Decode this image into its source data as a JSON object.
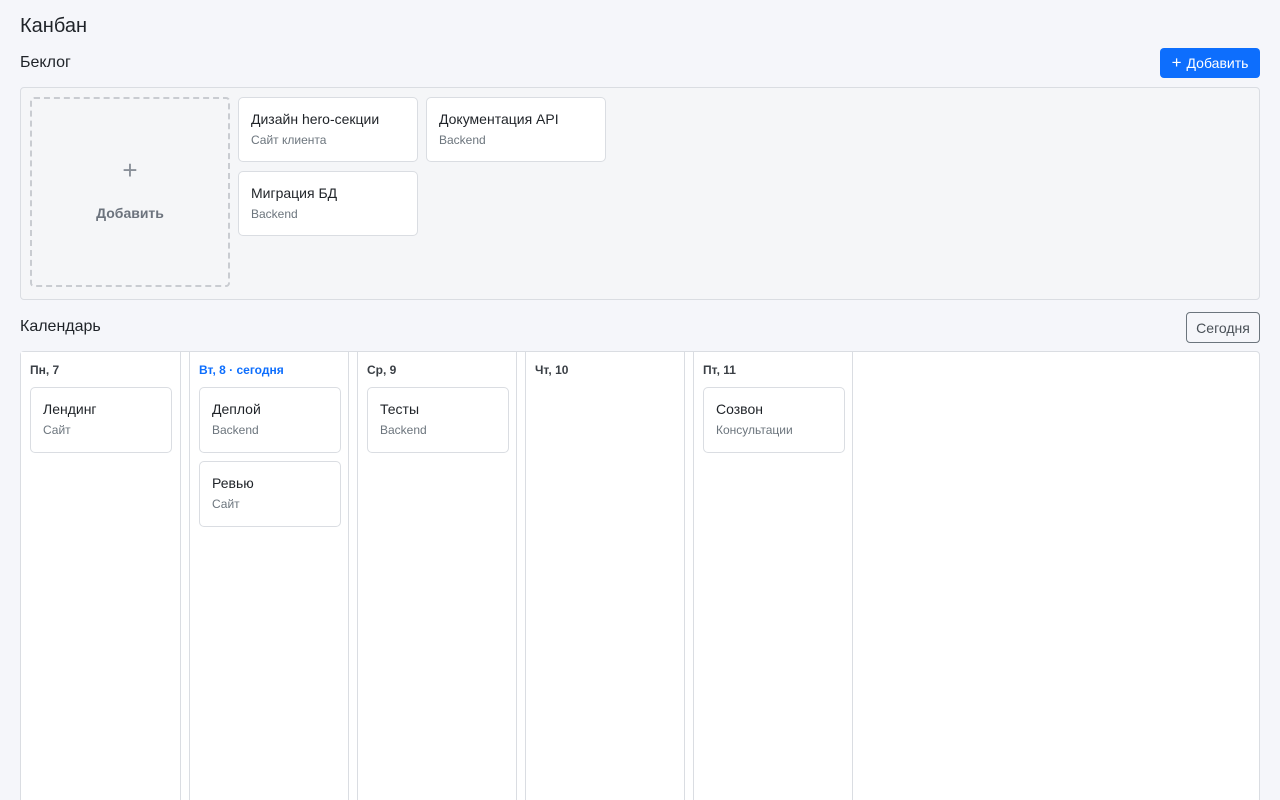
{
  "page": {
    "title": "Канбан"
  },
  "backlog": {
    "title": "Беклог",
    "add_button": "Добавить",
    "add_tile_label": "Добавить",
    "cards": [
      {
        "title": "Дизайн hero-секции",
        "subtitle": "Сайт клиента"
      },
      {
        "title": "Документация API",
        "subtitle": "Backend"
      },
      {
        "title": "Миграция БД",
        "subtitle": "Backend"
      }
    ]
  },
  "calendar": {
    "title": "Календарь",
    "today_button": "Сегодня",
    "days": [
      {
        "label": "Пн, 7",
        "is_today": false,
        "cards": [
          {
            "title": "Лендинг",
            "subtitle": "Сайт"
          }
        ]
      },
      {
        "label": "Вт, 8 · сегодня",
        "is_today": true,
        "cards": [
          {
            "title": "Деплой",
            "subtitle": "Backend"
          },
          {
            "title": "Ревью",
            "subtitle": "Сайт"
          }
        ]
      },
      {
        "label": "Ср, 9",
        "is_today": false,
        "cards": [
          {
            "title": "Тесты",
            "subtitle": "Backend"
          }
        ]
      },
      {
        "label": "Чт, 10",
        "is_today": false,
        "cards": []
      },
      {
        "label": "Пт, 11",
        "is_today": false,
        "cards": [
          {
            "title": "Созвон",
            "subtitle": "Консультации"
          }
        ]
      }
    ]
  },
  "colors": {
    "accent": "#0d6efd",
    "background": "#f5f6fa",
    "card_border": "#dadde2"
  },
  "icons": {
    "add_button_icon": "plus-icon",
    "add_tile_icon": "plus-icon"
  }
}
